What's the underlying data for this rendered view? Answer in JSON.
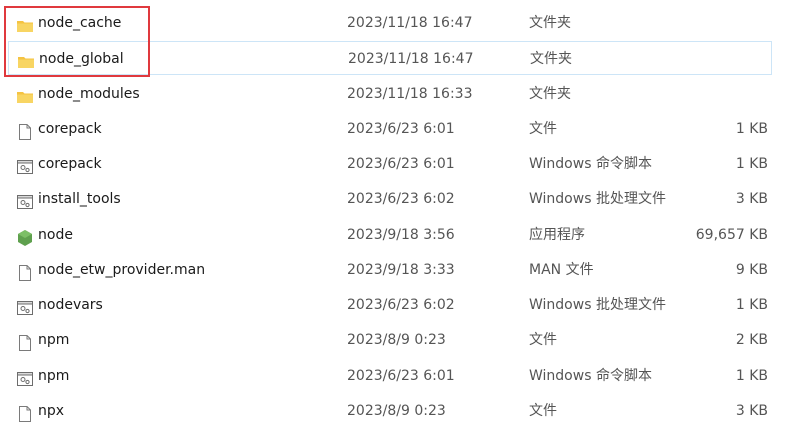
{
  "colors": {
    "highlight": "#e0393e",
    "folder": "#f5c342",
    "node_green": "#5fa04e",
    "hover_border": "#cde5f7"
  },
  "rows": [
    {
      "icon": "folder-icon",
      "name": "node_cache",
      "date": "2023/11/18 16:47",
      "type": "文件夹",
      "size": ""
    },
    {
      "icon": "folder-icon",
      "name": "node_global",
      "date": "2023/11/18 16:47",
      "type": "文件夹",
      "size": ""
    },
    {
      "icon": "folder-icon",
      "name": "node_modules",
      "date": "2023/11/18 16:33",
      "type": "文件夹",
      "size": ""
    },
    {
      "icon": "file-icon",
      "name": "corepack",
      "date": "2023/6/23 6:01",
      "type": "文件",
      "size": "1 KB"
    },
    {
      "icon": "script-icon",
      "name": "corepack",
      "date": "2023/6/23 6:01",
      "type": "Windows 命令脚本",
      "size": "1 KB"
    },
    {
      "icon": "script-icon",
      "name": "install_tools",
      "date": "2023/6/23 6:02",
      "type": "Windows 批处理文件",
      "size": "3 KB"
    },
    {
      "icon": "node-app-icon",
      "name": "node",
      "date": "2023/9/18 3:56",
      "type": "应用程序",
      "size": "69,657 KB"
    },
    {
      "icon": "file-icon",
      "name": "node_etw_provider.man",
      "date": "2023/9/18 3:33",
      "type": "MAN 文件",
      "size": "9 KB"
    },
    {
      "icon": "script-icon",
      "name": "nodevars",
      "date": "2023/6/23 6:02",
      "type": "Windows 批处理文件",
      "size": "1 KB"
    },
    {
      "icon": "file-icon",
      "name": "npm",
      "date": "2023/8/9 0:23",
      "type": "文件",
      "size": "2 KB"
    },
    {
      "icon": "script-icon",
      "name": "npm",
      "date": "2023/6/23 6:01",
      "type": "Windows 命令脚本",
      "size": "1 KB"
    },
    {
      "icon": "file-icon",
      "name": "npx",
      "date": "2023/8/9 0:23",
      "type": "文件",
      "size": "3 KB"
    }
  ]
}
